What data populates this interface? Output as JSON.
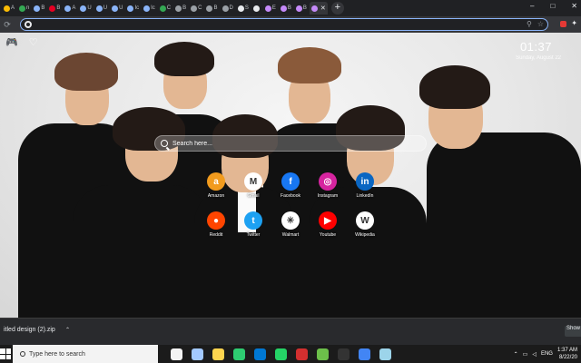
{
  "browser": {
    "tabs": [
      {
        "label": "A",
        "favicon_color": "#fbbc05"
      },
      {
        "label": "n",
        "favicon_color": "#34a853"
      },
      {
        "label": "B",
        "favicon_color": "#8ab4f8"
      },
      {
        "label": "B",
        "favicon_color": "#e60023"
      },
      {
        "label": "A",
        "favicon_color": "#8ab4f8"
      },
      {
        "label": "U",
        "favicon_color": "#8ab4f8"
      },
      {
        "label": "U",
        "favicon_color": "#8ab4f8"
      },
      {
        "label": "U",
        "favicon_color": "#8ab4f8"
      },
      {
        "label": "Ic",
        "favicon_color": "#8ab4f8"
      },
      {
        "label": "Ic",
        "favicon_color": "#8ab4f8"
      },
      {
        "label": "C",
        "favicon_color": "#34a853"
      },
      {
        "label": "B",
        "favicon_color": "#9aa0a6"
      },
      {
        "label": "C",
        "favicon_color": "#9aa0a6"
      },
      {
        "label": "B",
        "favicon_color": "#9aa0a6"
      },
      {
        "label": "D",
        "favicon_color": "#9aa0a6"
      },
      {
        "label": "S",
        "favicon_color": "#e8eaed"
      },
      {
        "label": "",
        "favicon_color": "#e8eaed"
      },
      {
        "label": "E",
        "favicon_color": "#c58af9"
      },
      {
        "label": "B",
        "favicon_color": "#c58af9"
      },
      {
        "label": "B",
        "favicon_color": "#c58af9"
      },
      {
        "label": "",
        "favicon_color": "#c58af9",
        "active": true
      }
    ],
    "new_tab_symbol": "+",
    "window_controls": [
      "–",
      "□",
      "✕"
    ],
    "omnibox": {
      "value": "",
      "placeholder": ""
    }
  },
  "newtab": {
    "clock": "01:37",
    "date": "Sunday, August 22",
    "search_placeholder": "Search here...",
    "shortcuts": [
      {
        "label": "Amazon",
        "glyph": "a",
        "color": "#f29b1d"
      },
      {
        "label": "Gmail",
        "glyph": "M",
        "color": "#ffffff"
      },
      {
        "label": "Facebook",
        "glyph": "f",
        "color": "#1877f2"
      },
      {
        "label": "Instagram",
        "glyph": "◎",
        "color": "#d6249f"
      },
      {
        "label": "LinkedIn",
        "glyph": "in",
        "color": "#0a66c2"
      },
      {
        "label": "Reddit",
        "glyph": "●",
        "color": "#ff4500"
      },
      {
        "label": "Twitter",
        "glyph": "t",
        "color": "#1da1f2"
      },
      {
        "label": "Walmart",
        "glyph": "✳",
        "color": "#ffffff"
      },
      {
        "label": "Youtube",
        "glyph": "▶",
        "color": "#ff0000"
      },
      {
        "label": "Wikipedia",
        "glyph": "W",
        "color": "#ffffff"
      }
    ]
  },
  "downloads": {
    "item": "itled design (2).zip",
    "show_all": "Show"
  },
  "taskbar": {
    "search_placeholder": "Type here to search",
    "apps": [
      "#f3f3f3",
      "#a3c9ff",
      "#ffd54f",
      "#2ecc71",
      "#0078d4",
      "#25d366",
      "#d32f2f",
      "#6cc04a",
      "#333333",
      "#4285f4",
      "#9cd4ea"
    ],
    "lang": "ENG",
    "time": "1:37 AM",
    "date": "8/22/20"
  }
}
